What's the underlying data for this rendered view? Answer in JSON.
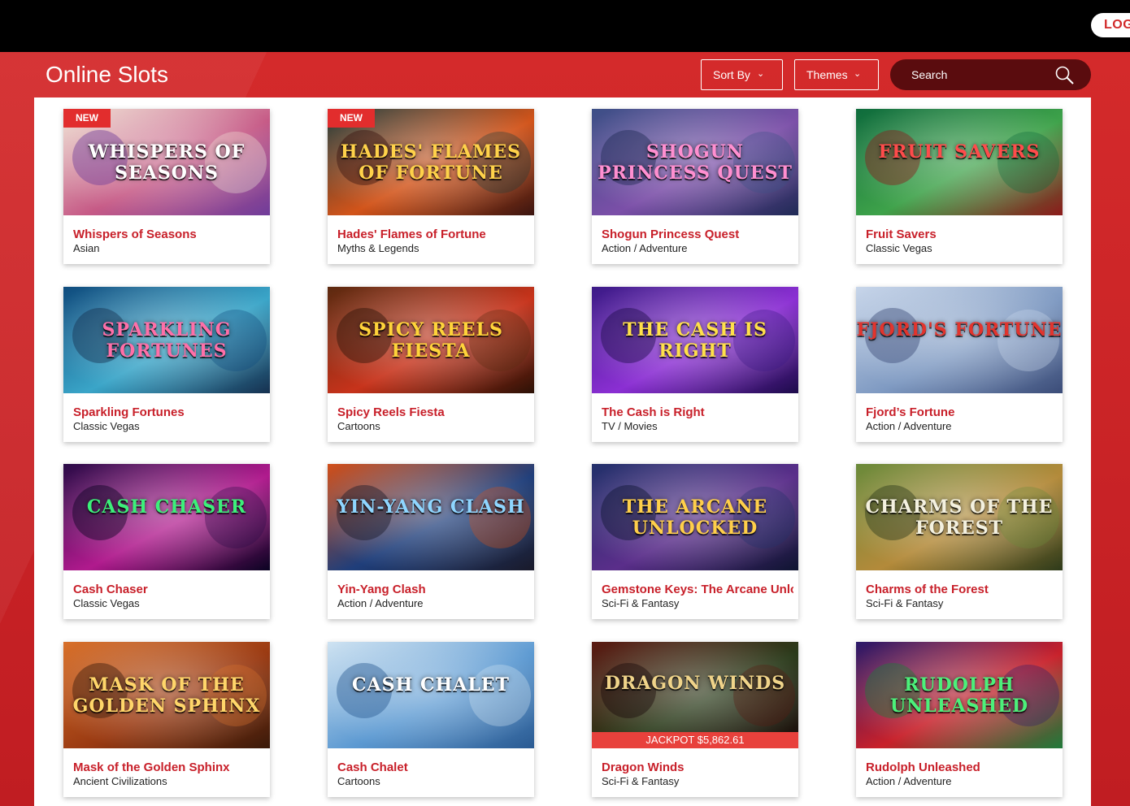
{
  "header": {
    "login_label": "LOG",
    "title": "Online Slots",
    "sort_label": "Sort By",
    "themes_label": "Themes",
    "search_placeholder": "Search"
  },
  "games": [
    {
      "title": "Whispers of Seasons",
      "theme": "Asian",
      "badge": "NEW",
      "logo": "WHISPERS OF SEASONS",
      "colors": [
        "#f1e6d6",
        "#c65a86",
        "#6f3c9a"
      ],
      "logo_color": "#ffffff"
    },
    {
      "title": "Hades' Flames of Fortune",
      "theme": "Myths & Legends",
      "badge": "NEW",
      "logo": "HADES' FLAMES OF FORTUNE",
      "colors": [
        "#1e3b3a",
        "#d2541a",
        "#3a1410"
      ],
      "logo_color": "#ffd24a"
    },
    {
      "title": "Shogun Princess Quest",
      "theme": "Action / Adventure",
      "logo": "SHOGUN PRINCESS QUEST",
      "colors": [
        "#3c4f86",
        "#7b4fa8",
        "#1f2a55"
      ],
      "logo_color": "#ff8fd0"
    },
    {
      "title": "Fruit Savers",
      "theme": "Classic Vegas",
      "logo": "FRUIT SAVERS",
      "colors": [
        "#0e6b3c",
        "#3ea24a",
        "#8c1a1a"
      ],
      "logo_color": "#ff4b4b"
    },
    {
      "title": "Sparkling Fortunes",
      "theme": "Classic Vegas",
      "logo": "SPARKLING FORTUNES",
      "colors": [
        "#0f4b7d",
        "#3aa5c8",
        "#16304f"
      ],
      "logo_color": "#ff6fa8"
    },
    {
      "title": "Spicy Reels Fiesta",
      "theme": "Cartoons",
      "logo": "SPICY REELS FIESTA",
      "colors": [
        "#5b2a10",
        "#c7331b",
        "#2b1106"
      ],
      "logo_color": "#ffd43a"
    },
    {
      "title": "The Cash is Right",
      "theme": "TV / Movies",
      "logo": "THE CASH IS RIGHT",
      "colors": [
        "#3b1a86",
        "#8b2fd3",
        "#1c0b4a"
      ],
      "logo_color": "#ffe04a"
    },
    {
      "title": "Fjord’s Fortune",
      "theme": "Action / Adventure",
      "logo": "FJORD'S FORTUNE",
      "colors": [
        "#c8d6ea",
        "#7f9ac2",
        "#3b4c78"
      ],
      "logo_color": "#e2342d"
    },
    {
      "title": "Cash Chaser",
      "theme": "Classic Vegas",
      "logo": "CASH CHASER",
      "colors": [
        "#2a0b47",
        "#b01a8d",
        "#0a0322"
      ],
      "logo_color": "#3cf07a"
    },
    {
      "title": "Yin-Yang Clash",
      "theme": "Action / Adventure",
      "logo": "YIN-YANG CLASH",
      "colors": [
        "#d2501a",
        "#1f3e7a",
        "#1a1a2a"
      ],
      "logo_color": "#8fd6ff"
    },
    {
      "title": "Gemstone Keys: The Arcane Unlocked",
      "theme": "Sci-Fi & Fantasy",
      "logo": "THE ARCANE UNLOCKED",
      "colors": [
        "#22306a",
        "#5a2e8a",
        "#0e1430"
      ],
      "logo_color": "#ffcf4a"
    },
    {
      "title": "Charms of the Forest",
      "theme": "Sci-Fi & Fantasy",
      "logo": "CHARMS OF THE FOREST",
      "colors": [
        "#6a8a3a",
        "#b38a3a",
        "#2d3a1a"
      ],
      "logo_color": "#f4f1e0"
    },
    {
      "title": "Mask of the Golden Sphinx",
      "theme": "Ancient Civilizations",
      "logo": "MASK OF THE GOLDEN SPHINX",
      "colors": [
        "#d8702a",
        "#9a3a12",
        "#3a1a0a"
      ],
      "logo_color": "#ffd66a"
    },
    {
      "title": "Cash Chalet",
      "theme": "Cartoons",
      "logo": "CASH CHALET",
      "colors": [
        "#cfe3f2",
        "#5d9ad2",
        "#2a5a92"
      ],
      "logo_color": "#ffffff"
    },
    {
      "title": "Dragon Winds",
      "theme": "Sci-Fi & Fantasy",
      "logo": "DRAGON WINDS",
      "jackpot": "JACKPOT $5,862.61",
      "colors": [
        "#5a1a12",
        "#2a3a1a",
        "#1a0a0a"
      ],
      "logo_color": "#f0d48a"
    },
    {
      "title": "Rudolph Unleashed",
      "theme": "Action / Adventure",
      "logo": "RUDOLPH UNLEASHED",
      "colors": [
        "#2a1a6a",
        "#c8202a",
        "#1f7a3a"
      ],
      "logo_color": "#4cf07a"
    }
  ]
}
